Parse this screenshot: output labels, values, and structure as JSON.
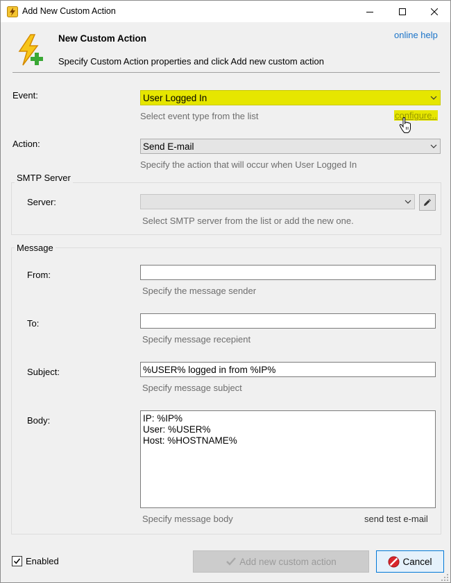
{
  "window": {
    "title": "Add New Custom Action",
    "minimize_glyph": "—",
    "maximize_glyph": "☐",
    "close_glyph": "✕"
  },
  "header": {
    "title": "New Custom Action",
    "subtitle": "Specify Custom Action properties and click Add new custom action",
    "online_help": "online help",
    "icon": "lightning-plus-icon"
  },
  "event": {
    "label": "Event:",
    "value": "User Logged In",
    "hint": "Select event type from the list",
    "configure_link": "configure..",
    "highlight_color": "#e6e600"
  },
  "action": {
    "label": "Action:",
    "value": "Send E-mail",
    "hint": "Specify the action that will occur when User Logged In"
  },
  "smtp": {
    "group_title": "SMTP Server",
    "server_label": "Server:",
    "server_value": "",
    "hint": "Select SMTP server from the list or add the new one.",
    "edit_icon": "pencil-icon"
  },
  "message": {
    "group_title": "Message",
    "from_label": "From:",
    "from_value": "",
    "from_hint": "Specify the message sender",
    "to_label": "To:",
    "to_value": "",
    "to_hint": "Specify message recepient",
    "subject_label": "Subject:",
    "subject_value": "%USER% logged in from %IP%",
    "subject_hint": "Specify message subject",
    "body_label": "Body:",
    "body_value": "IP: %IP%\nUser: %USER%\nHost: %HOSTNAME%",
    "body_hint": "Specify message body",
    "send_test": "send test e-mail"
  },
  "footer": {
    "enabled_label": "Enabled",
    "enabled_checked": true,
    "add_button": "Add new custom action",
    "cancel_button": "Cancel",
    "cancel_icon": "no-entry-icon"
  }
}
